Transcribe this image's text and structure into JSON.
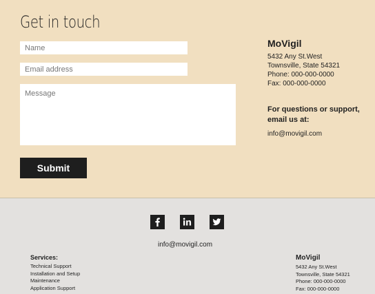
{
  "contact": {
    "title": "Get in touch",
    "name_placeholder": "Name",
    "email_placeholder": "Email address",
    "message_placeholder": "Message",
    "submit_label": "Submit"
  },
  "company": {
    "name": "MoVigil",
    "address1": "5432 Any St.West",
    "address2": "Townsville, State 54321",
    "phone": "Phone: 000-000-0000",
    "fax": "Fax: 000-000-0000",
    "support_heading": "For questions or support, email us at:",
    "email": "info@movigil.com"
  },
  "footer": {
    "social": [
      {
        "icon": "facebook-icon",
        "glyph": "f"
      },
      {
        "icon": "linkedin-icon",
        "glyph": "in"
      },
      {
        "icon": "twitter-icon",
        "glyph": "bird"
      }
    ],
    "email": "info@movigil.com",
    "services_heading": "Services:",
    "services": [
      "Technical Support",
      "Installation and Setup",
      "Maintenance",
      "Application Support"
    ],
    "company_name": "MoVigil",
    "address1": "5432 Any St.West",
    "address2": "Townsville, State 54321",
    "phone": "Phone: 000-000-0000",
    "fax": "Fax: 000-000-0000"
  },
  "colors": {
    "contact_bg": "#f1dfc0",
    "footer_bg": "#e3e1df",
    "button_bg": "#1e1e1e"
  }
}
